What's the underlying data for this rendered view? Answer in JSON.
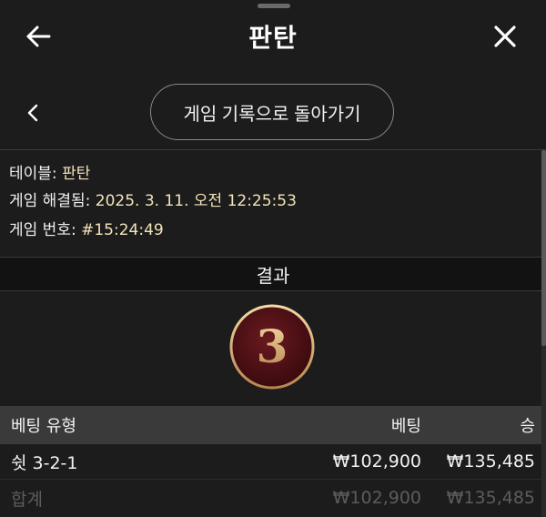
{
  "header": {
    "title": "판탄"
  },
  "nav": {
    "back_history_label": "게임 기록으로 돌아가기"
  },
  "info": {
    "table_label": "테이블:",
    "table_value": "판탄",
    "resolved_label": "게임 해결됨:",
    "resolved_value": "2025. 3. 11. 오전 12:25:53",
    "game_no_label": "게임 번호:",
    "game_no_value": "#15:24:49"
  },
  "result": {
    "heading": "결과",
    "number": "3"
  },
  "bets": {
    "columns": {
      "type": "베팅 유형",
      "bet": "베팅",
      "win": "승"
    },
    "rows": [
      {
        "type": "쉿 3-2-1",
        "bet": "₩102,900",
        "win": "₩135,485"
      }
    ],
    "total": {
      "label": "합계",
      "bet": "₩102,900",
      "win": "₩135,485"
    }
  },
  "colors": {
    "background": "#1c1c1c",
    "value_text": "#f3e3b8",
    "dice_fill": "#4a0f14",
    "dice_ring": "#c9a06a",
    "header_row": "#3a3a3a"
  },
  "icons": [
    "arrow-left-icon",
    "close-icon",
    "chevron-left-icon"
  ]
}
